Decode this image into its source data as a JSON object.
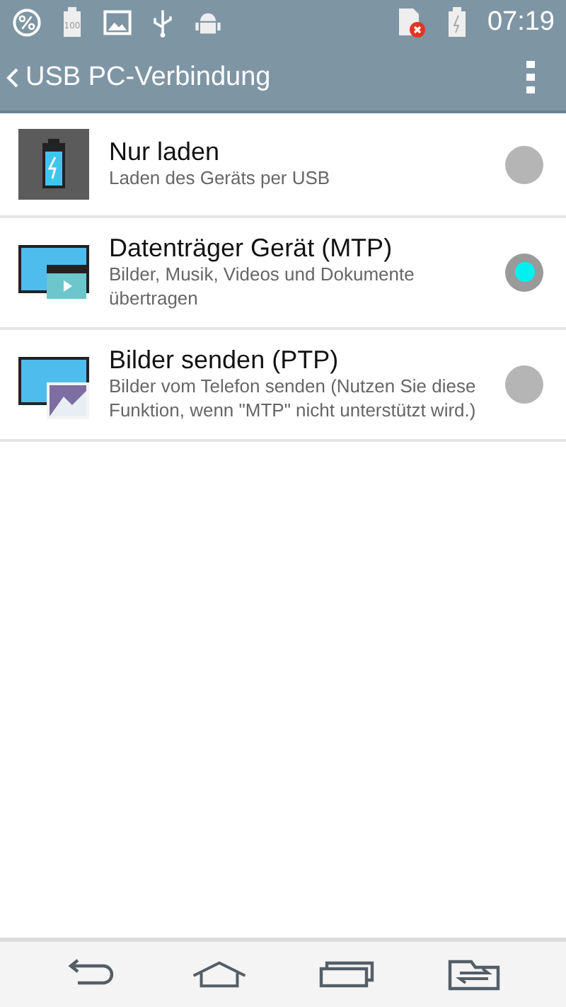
{
  "status_bar": {
    "battery_level_label": "100",
    "time": "07:19"
  },
  "app_bar": {
    "title": "USB PC-Verbindung"
  },
  "options": [
    {
      "kind": "charge",
      "title": "Nur laden",
      "subtitle": "Laden des Geräts per USB",
      "selected": false
    },
    {
      "kind": "media",
      "title": "Datenträger Gerät (MTP)",
      "subtitle": "Bilder, Musik, Videos und Dokumente übertragen",
      "selected": true
    },
    {
      "kind": "photo",
      "title": "Bilder senden (PTP)",
      "subtitle": "Bilder vom Telefon senden (Nutzen Sie diese Funktion, wenn \"MTP\" nicht unterstützt wird.)",
      "selected": false
    }
  ]
}
